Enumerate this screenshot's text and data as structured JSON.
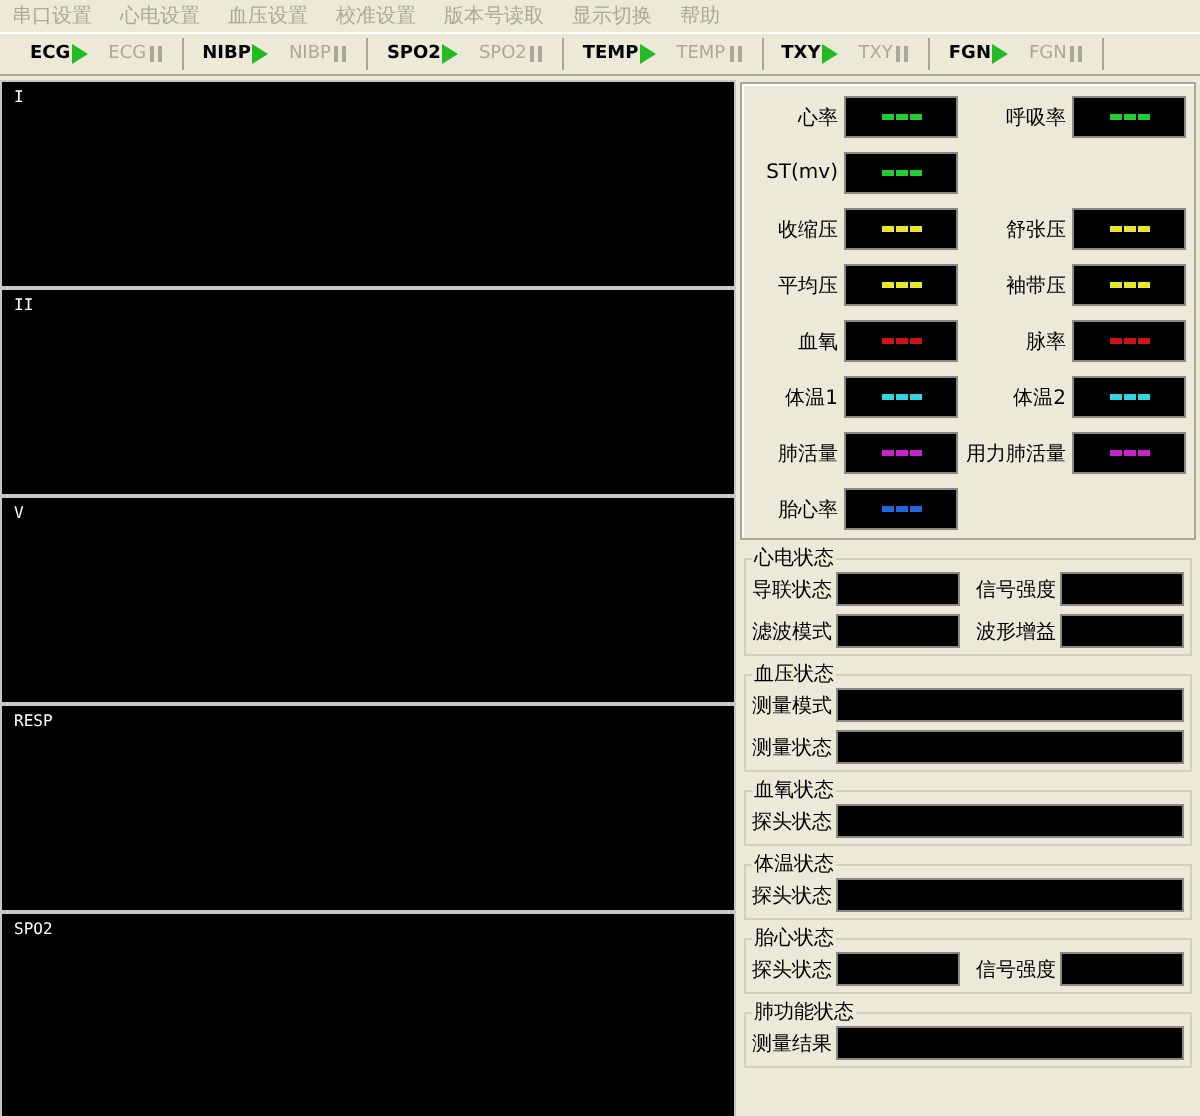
{
  "menu": [
    {
      "label": "串口设置",
      "disabled": true
    },
    {
      "label": "心电设置",
      "disabled": true
    },
    {
      "label": "血压设置",
      "disabled": true
    },
    {
      "label": "校准设置",
      "disabled": true
    },
    {
      "label": "版本号读取",
      "disabled": true
    },
    {
      "label": "显示切换",
      "disabled": true
    },
    {
      "label": "帮助",
      "disabled": true
    }
  ],
  "toolbar": [
    [
      {
        "label": "ECG",
        "kind": "start",
        "disabled": false
      },
      {
        "label": "ECG",
        "kind": "stop",
        "disabled": true
      }
    ],
    [
      {
        "label": "NIBP",
        "kind": "start",
        "disabled": false
      },
      {
        "label": "NIBP",
        "kind": "stop",
        "disabled": true
      }
    ],
    [
      {
        "label": "SPO2",
        "kind": "start",
        "disabled": false
      },
      {
        "label": "SPO2",
        "kind": "stop",
        "disabled": true
      }
    ],
    [
      {
        "label": "TEMP",
        "kind": "start",
        "disabled": false
      },
      {
        "label": "TEMP",
        "kind": "stop",
        "disabled": true
      }
    ],
    [
      {
        "label": "TXY",
        "kind": "start",
        "disabled": false
      },
      {
        "label": "TXY",
        "kind": "stop",
        "disabled": true
      }
    ],
    [
      {
        "label": "FGN",
        "kind": "start",
        "disabled": false
      },
      {
        "label": "FGN",
        "kind": "stop",
        "disabled": true
      }
    ]
  ],
  "waveforms": [
    {
      "label": "I"
    },
    {
      "label": "II"
    },
    {
      "label": "V"
    },
    {
      "label": "RESP"
    },
    {
      "label": "SPO2"
    }
  ],
  "readouts": [
    [
      {
        "label": "心率",
        "color": "#22cc33"
      },
      {
        "label": "呼吸率",
        "color": "#22cc33"
      }
    ],
    [
      {
        "label": "ST(mv)",
        "color": "#22cc33"
      }
    ],
    [
      {
        "label": "收缩压",
        "color": "#e6e62e"
      },
      {
        "label": "舒张压",
        "color": "#e6e62e"
      }
    ],
    [
      {
        "label": "平均压",
        "color": "#e6e62e"
      },
      {
        "label": "袖带压",
        "color": "#e6e62e"
      }
    ],
    [
      {
        "label": "血氧",
        "color": "#cc1414"
      },
      {
        "label": "脉率",
        "color": "#cc1414"
      }
    ],
    [
      {
        "label": "体温1",
        "color": "#33d6e0"
      },
      {
        "label": "体温2",
        "color": "#33d6e0"
      }
    ],
    [
      {
        "label": "肺活量",
        "color": "#cc22cc"
      },
      {
        "label": "用力肺活量",
        "color": "#cc22cc"
      }
    ],
    [
      {
        "label": "胎心率",
        "color": "#2266dd"
      }
    ]
  ],
  "status_groups": [
    {
      "title": "心电状态",
      "rows": [
        [
          {
            "label": "导联状态",
            "kind": "half"
          },
          {
            "label": "信号强度",
            "kind": "half"
          }
        ],
        [
          {
            "label": "滤波模式",
            "kind": "half"
          },
          {
            "label": "波形增益",
            "kind": "half"
          }
        ]
      ]
    },
    {
      "title": "血压状态",
      "rows": [
        [
          {
            "label": "测量模式",
            "kind": "full"
          }
        ],
        [
          {
            "label": "测量状态",
            "kind": "full"
          }
        ]
      ]
    },
    {
      "title": "血氧状态",
      "rows": [
        [
          {
            "label": "探头状态",
            "kind": "full"
          }
        ]
      ]
    },
    {
      "title": "体温状态",
      "rows": [
        [
          {
            "label": "探头状态",
            "kind": "full"
          }
        ]
      ]
    },
    {
      "title": "胎心状态",
      "rows": [
        [
          {
            "label": "探头状态",
            "kind": "half"
          },
          {
            "label": "信号强度",
            "kind": "half"
          }
        ]
      ]
    },
    {
      "title": "肺功能状态",
      "rows": [
        [
          {
            "label": "测量结果",
            "kind": "full"
          }
        ]
      ]
    }
  ]
}
